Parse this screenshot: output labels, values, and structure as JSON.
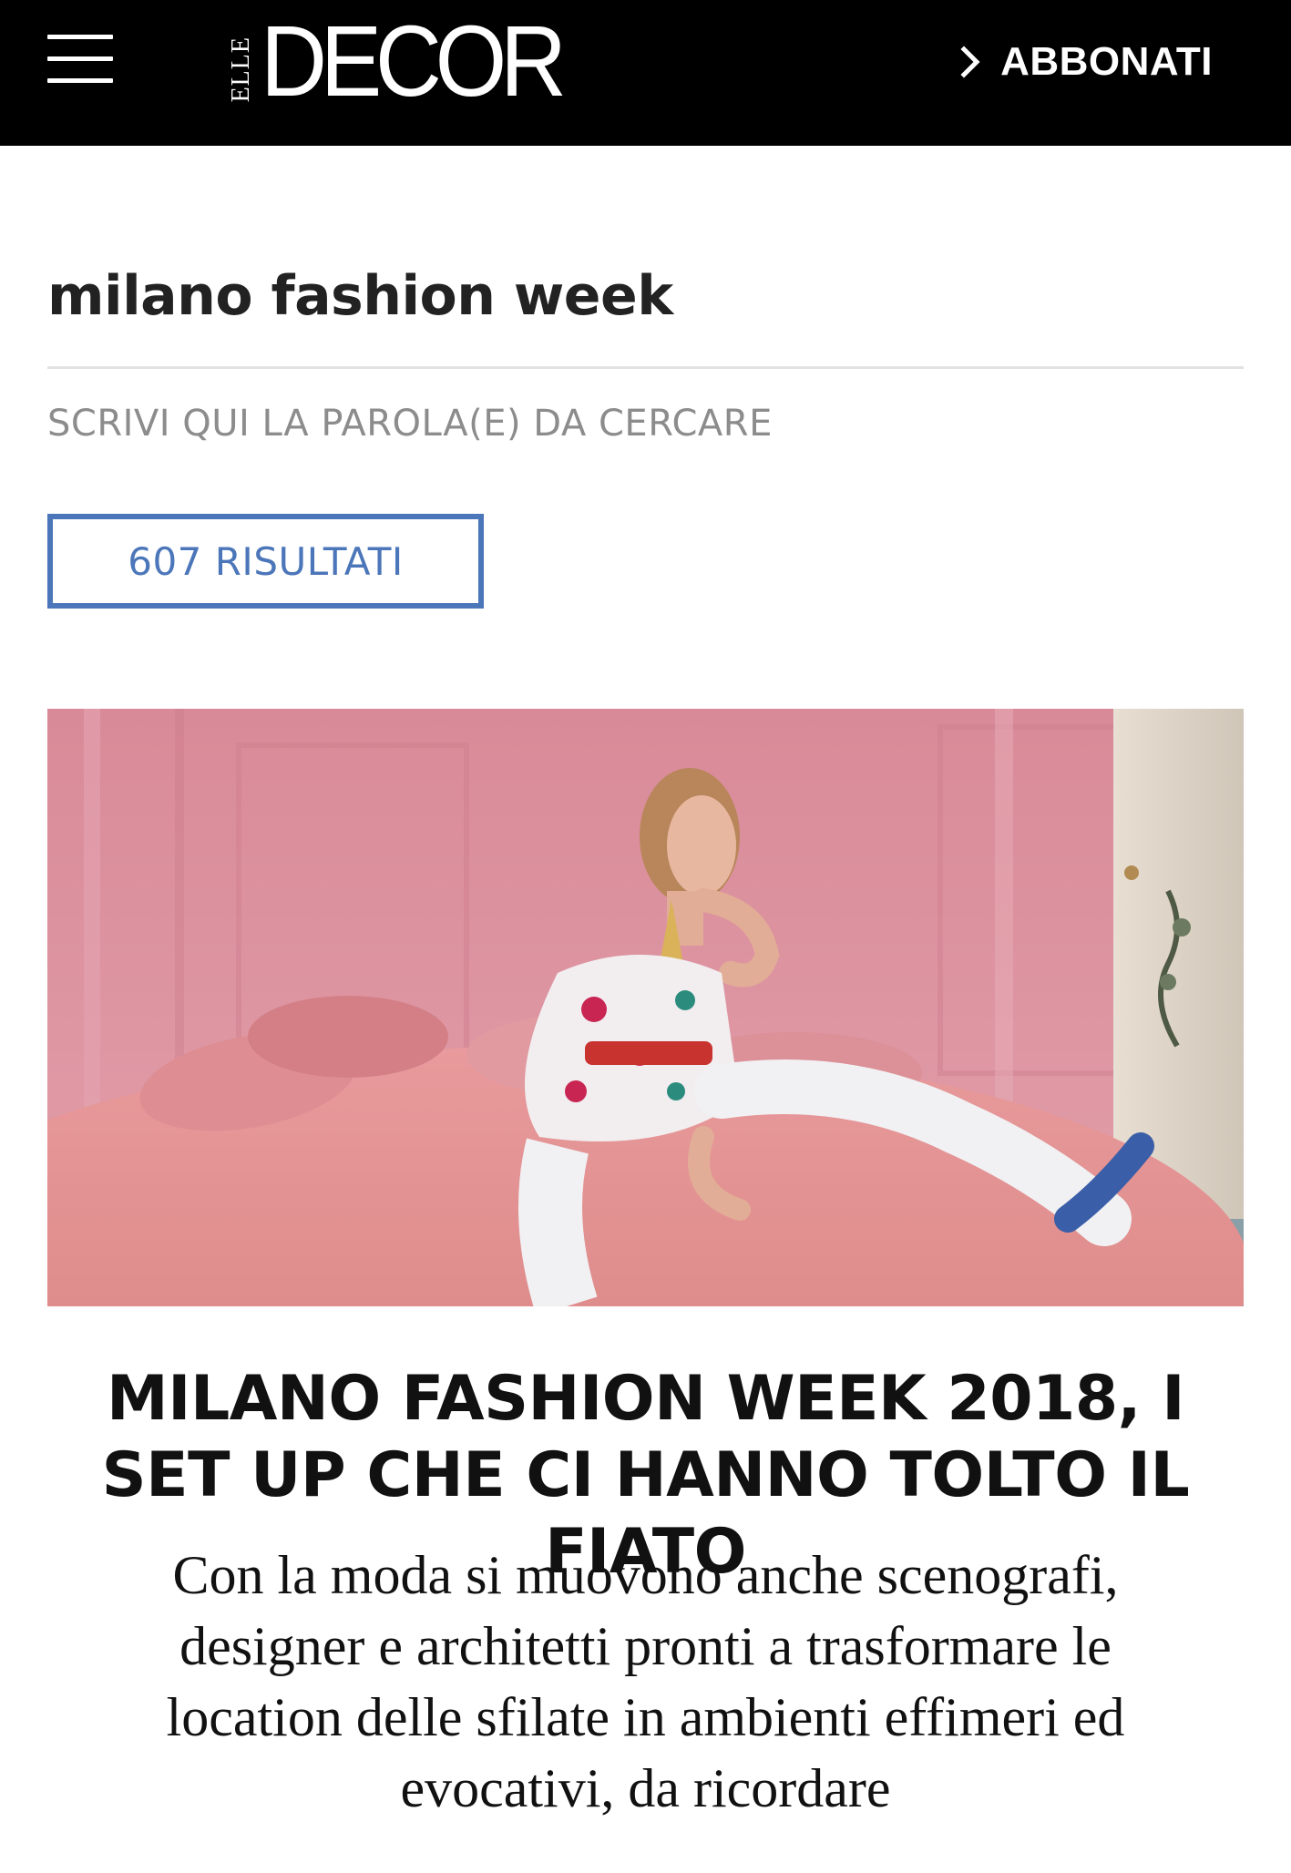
{
  "header": {
    "menu_icon": "hamburger-menu-icon",
    "logo": {
      "small": "ELLE",
      "main": "DECOR"
    },
    "subscribe_label": "ABBONATI",
    "subscribe_icon": "chevron-right-icon",
    "background": "#000000"
  },
  "search": {
    "query": "milano fashion week",
    "placeholder": "SCRIVI QUI LA PAROLA(E) DA CERCARE",
    "results_label": "607 RISULTATI",
    "accent_color": "#4b76b9"
  },
  "article": {
    "title": "MILANO FASHION WEEK 2018, I SET UP CHE CI HANNO TOLTO IL FIATO",
    "dek": "Con la moda si muovono anche scenografi, designer e architetti pronti a trasformare le location delle sfilate in ambienti effimeri ed evocativi, da ricordare"
  }
}
